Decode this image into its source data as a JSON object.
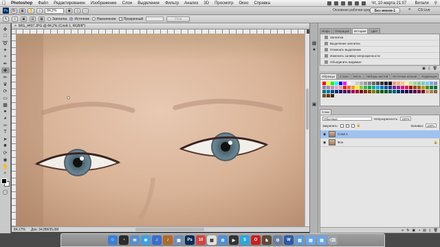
{
  "menubar": {
    "app": "Photoshop",
    "items": [
      "Файл",
      "Редактирование",
      "Изображение",
      "Слои",
      "Выделение",
      "Фильтр",
      "Анализ",
      "3D",
      "Просмотр",
      "Окно",
      "Справка"
    ],
    "datetime": "Чт, 10 марта 21:07",
    "user": "Виталя"
  },
  "appbar": {
    "logo": "Ps",
    "zoom": "84,2%",
    "workspace_label": "Основная рабочая среда",
    "workspace_button": "Без имени-1",
    "cs_live": "CS Live"
  },
  "options": {
    "items": [
      {
        "label": "Заплатка",
        "type": "radio",
        "checked": false
      },
      {
        "label": "Источник",
        "type": "radio",
        "checked": true
      },
      {
        "label": "Назначение",
        "type": "radio",
        "checked": false
      },
      {
        "label": "Прозрачный",
        "type": "checkbox",
        "checked": false
      }
    ],
    "pattern_button": "Узор"
  },
  "document": {
    "tab_title": "IMG_4497.JPG @ 84,2% (Слой 1, RGB/8*)",
    "zoom_status": "84,17%",
    "doc_status": "Док: 34,8М/35,0М"
  },
  "history_panel": {
    "tabs": [
      "Инфо",
      "Операции",
      "История",
      "Цвет"
    ],
    "active_tab": "История",
    "rows": [
      {
        "label": "Заплатка",
        "selected": false
      },
      {
        "label": "Выделение заплатки",
        "selected": false
      },
      {
        "label": "Отменить выделение",
        "selected": false
      },
      {
        "label": "Изменить заливку непрозрачности",
        "selected": false
      },
      {
        "label": "Объединить видимые",
        "selected": false
      },
      {
        "label": "Скопировать на новый слой",
        "selected": true
      }
    ]
  },
  "swatches_panel": {
    "tabs": [
      "Образцы",
      "Стили",
      "Кисть",
      "Наборы кистей",
      "Источник клонов",
      "Коррекция"
    ],
    "active_tab": "Образцы",
    "colors": [
      "#ff0000",
      "#ffff00",
      "#00ff00",
      "#00ffff",
      "#0000ff",
      "#ff00ff",
      "#ffffff",
      "#e6e6e6",
      "#cccccc",
      "#b3b3b3",
      "#999999",
      "#808080",
      "#666666",
      "#4d4d4d",
      "#333333",
      "#1a1a1a",
      "#000000",
      "#f7977a",
      "#f9ad81",
      "#fdc68a",
      "#fff79a",
      "#c4df9b",
      "#a2d39c",
      "#82ca9d",
      "#7bcdc8",
      "#6ecff6",
      "#7ea7d8",
      "#8493ca",
      "#8882be",
      "#a187be",
      "#bc8dbf",
      "#f49ac2",
      "#f6989d",
      "#ed1c24",
      "#f26522",
      "#f7941d",
      "#fff200",
      "#8dc63f",
      "#39b54a",
      "#00a651",
      "#00a99d",
      "#00aeef",
      "#0072bc",
      "#0054a6",
      "#2e3192",
      "#662d91",
      "#92278f",
      "#ec008c",
      "#ed145b",
      "#9e0b0f",
      "#a0410d",
      "#a3620a",
      "#aba000",
      "#598527",
      "#1a7b30",
      "#007236",
      "#00746b",
      "#0076a3",
      "#004a80",
      "#003471",
      "#1b1464",
      "#440e62",
      "#630460",
      "#9e005d",
      "#9e0039",
      "#790000",
      "#7b2e00",
      "#7d4900",
      "#827b00",
      "#406618",
      "#005e20",
      "#005826",
      "#005952",
      "#005b7f",
      "#003663",
      "#002157",
      "#0d004c",
      "#32004b",
      "#4b0049",
      "#7b0046",
      "#7a0026",
      "#c69c6d",
      "#a67c52",
      "#8c6239",
      "#754c24",
      "#603913",
      "#3c2415"
    ]
  },
  "layers_panel": {
    "tabs": [
      "Слои"
    ],
    "blend_mode": "Обычные",
    "opacity_label": "Непрозрачность:",
    "opacity_value": "100%",
    "lock_label": "Закрепить:",
    "fill_label": "Заливка:",
    "fill_value": "100%",
    "layers": [
      {
        "name": "Слой 1",
        "selected": true,
        "locked": false
      },
      {
        "name": "Фон",
        "selected": false,
        "locked": true
      }
    ]
  },
  "dock": {
    "icons": [
      {
        "name": "finder-icon",
        "color": "#3b7fd9",
        "glyph": "☺"
      },
      {
        "name": "dashboard-icon",
        "color": "#2b2b2b",
        "glyph": "◔"
      },
      {
        "name": "mail-icon",
        "color": "#5b8ec9",
        "glyph": "✉"
      },
      {
        "name": "safari-icon",
        "color": "#3aa0e8",
        "glyph": "✹"
      },
      {
        "name": "itunes-icon",
        "color": "#3a6fd0",
        "glyph": "♫"
      },
      {
        "name": "guitar-icon",
        "color": "#b06a2a",
        "glyph": "♪"
      },
      {
        "name": "preview-icon",
        "color": "#6e8fb8",
        "glyph": "▣"
      },
      {
        "name": "photoshop-icon",
        "color": "#0b2d57",
        "glyph": "Ps"
      },
      {
        "name": "calendar-icon",
        "color": "#d84040",
        "glyph": "10"
      },
      {
        "name": "ical-icon",
        "color": "#e0e0e0",
        "glyph": "▦"
      },
      {
        "name": "iphoto-icon",
        "color": "#4f8fd6",
        "glyph": "✿"
      },
      {
        "name": "movie-icon",
        "color": "#333333",
        "glyph": "▶"
      },
      {
        "name": "skype-icon",
        "color": "#2aa7e0",
        "glyph": "S"
      },
      {
        "name": "opera-icon",
        "color": "#cc1f1f",
        "glyph": "O"
      },
      {
        "name": "chess-icon",
        "color": "#5a4a3a",
        "glyph": "♞"
      },
      {
        "name": "utility-icon",
        "color": "#6a7fa0",
        "glyph": "⚙"
      },
      {
        "name": "word-icon",
        "color": "#2a5aa8",
        "glyph": "W"
      },
      {
        "name": "folder-apps-icon",
        "color": "#5c9ae0",
        "glyph": "▤"
      },
      {
        "name": "folder-docs-icon",
        "color": "#6aa5e8",
        "glyph": "▤"
      },
      {
        "name": "folder-downloads-icon",
        "color": "#6aa5e8",
        "glyph": "▤"
      },
      {
        "name": "trash-icon",
        "color": "#9aa3ad",
        "glyph": "⌫"
      }
    ]
  }
}
